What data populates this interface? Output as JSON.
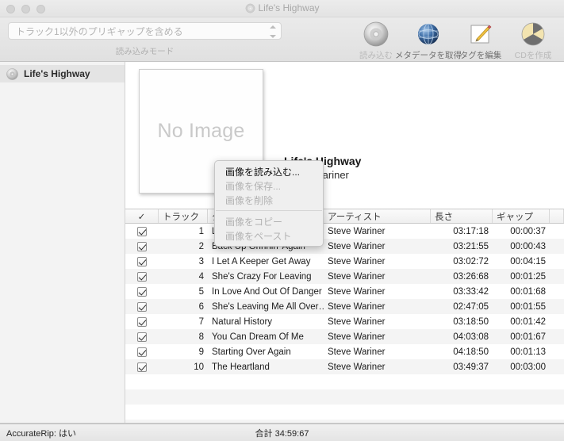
{
  "window": {
    "title": "Life's Highway",
    "title_icon": "cd-disc-icon",
    "traffic_lights": [
      "close-button",
      "minimize-button",
      "zoom-button"
    ]
  },
  "toolbar": {
    "mode_select": {
      "value": "トラック1以外のプリギャップを含める",
      "label": "読み込みモード"
    },
    "buttons": [
      {
        "label": "読み込む",
        "icon": "cd-disc-icon",
        "enabled": false
      },
      {
        "label": "メタデータを取得",
        "icon": "globe-icon",
        "enabled": true
      },
      {
        "label": "タグを編集",
        "icon": "pencil-edit-icon",
        "enabled": true
      },
      {
        "label": "CDを作成",
        "icon": "burn-disc-icon",
        "enabled": false
      }
    ]
  },
  "sidebar": {
    "items": [
      {
        "label": "Life's Highway",
        "icon": "cd-disc-icon",
        "selected": true
      }
    ]
  },
  "album": {
    "artwork_placeholder": "No Image",
    "title": "Life's Highway",
    "artist": "Steve Wariner"
  },
  "context_menu": {
    "items": [
      {
        "label": "画像を読み込む...",
        "enabled": true,
        "separator_after": false
      },
      {
        "label": "画像を保存...",
        "enabled": false,
        "separator_after": false
      },
      {
        "label": "画像を削除",
        "enabled": false,
        "separator_after": true
      },
      {
        "label": "画像をコピー",
        "enabled": false,
        "separator_after": false
      },
      {
        "label": "画像をペースト",
        "enabled": false,
        "separator_after": false
      }
    ]
  },
  "track_table": {
    "headers": {
      "check": "✓",
      "track": "トラック",
      "title": "タイトル",
      "artist": "アーティスト",
      "length": "長さ",
      "gap": "ギャップ"
    },
    "rows": [
      {
        "checked": true,
        "num": "1",
        "title": "Life's Highway",
        "artist": "Steve Wariner",
        "length": "03:17:18",
        "gap": "00:00:37"
      },
      {
        "checked": true,
        "num": "2",
        "title": "Back Up Grinnin' Again",
        "artist": "Steve Wariner",
        "length": "03:21:55",
        "gap": "00:00:43"
      },
      {
        "checked": true,
        "num": "3",
        "title": "I Let A Keeper Get Away",
        "artist": "Steve Wariner",
        "length": "03:02:72",
        "gap": "00:04:15"
      },
      {
        "checked": true,
        "num": "4",
        "title": "She's Crazy For Leaving",
        "artist": "Steve Wariner",
        "length": "03:26:68",
        "gap": "00:01:25"
      },
      {
        "checked": true,
        "num": "5",
        "title": "In Love And Out Of Danger",
        "artist": "Steve Wariner",
        "length": "03:33:42",
        "gap": "00:01:68"
      },
      {
        "checked": true,
        "num": "6",
        "title": "She's Leaving Me All Over…",
        "artist": "Steve Wariner",
        "length": "02:47:05",
        "gap": "00:01:55"
      },
      {
        "checked": true,
        "num": "7",
        "title": "Natural History",
        "artist": "Steve Wariner",
        "length": "03:18:50",
        "gap": "00:01:42"
      },
      {
        "checked": true,
        "num": "8",
        "title": "You Can Dream Of Me",
        "artist": "Steve Wariner",
        "length": "04:03:08",
        "gap": "00:01:67"
      },
      {
        "checked": true,
        "num": "9",
        "title": "Starting Over Again",
        "artist": "Steve Wariner",
        "length": "04:18:50",
        "gap": "00:01:13"
      },
      {
        "checked": true,
        "num": "10",
        "title": "The Heartland",
        "artist": "Steve Wariner",
        "length": "03:49:37",
        "gap": "00:03:00"
      }
    ]
  },
  "statusbar": {
    "accuraterip": "AccurateRip: はい",
    "total": "合計 34:59:67"
  }
}
